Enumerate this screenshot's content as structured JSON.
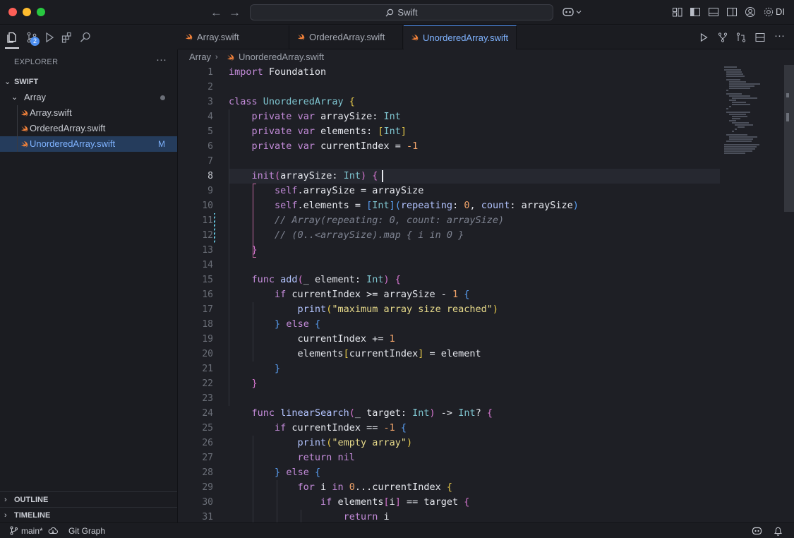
{
  "titlebar": {
    "search_label": "Swift",
    "account_label": "DI"
  },
  "sidebar": {
    "title": "EXPLORER",
    "more": "···",
    "scm_badge": "2",
    "root_folder": "SWIFT",
    "folder": "Array",
    "files": [
      {
        "name": "Array.swift",
        "status": ""
      },
      {
        "name": "OrderedArray.swift",
        "status": ""
      },
      {
        "name": "UnorderedArray.swift",
        "status": "M"
      }
    ],
    "outline_label": "OUTLINE",
    "timeline_label": "TIMELINE"
  },
  "tabs": [
    {
      "label": "Array.swift",
      "active": false
    },
    {
      "label": "OrderedArray.swift",
      "active": false
    },
    {
      "label": "UnorderedArray.swift",
      "active": true
    }
  ],
  "breadcrumb": {
    "root": "Array",
    "file": "UnorderedArray.swift"
  },
  "editor": {
    "active_line": 8,
    "line_numbers": [
      "1",
      "2",
      "3",
      "4",
      "5",
      "6",
      "7",
      "8",
      "9",
      "10",
      "11",
      "12",
      "13",
      "14",
      "15",
      "16",
      "17",
      "18",
      "19",
      "20",
      "21",
      "22",
      "23",
      "24",
      "25",
      "26",
      "27",
      "28",
      "29",
      "30",
      "31"
    ]
  },
  "statusbar": {
    "branch": "main*",
    "git_graph": "Git Graph"
  },
  "colors": {
    "accent": "#4d8ff0",
    "active_file": "#7fb3ff",
    "swift_orange": "#f0813a"
  }
}
